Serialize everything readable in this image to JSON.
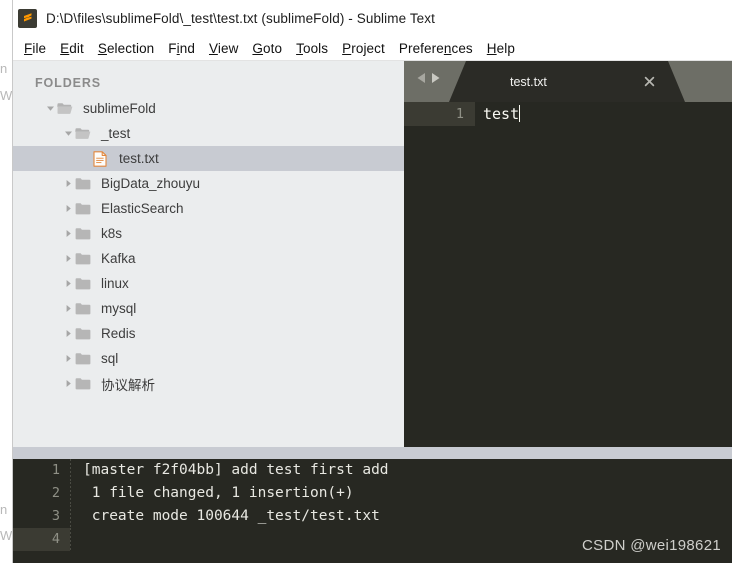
{
  "window": {
    "title": "D:\\D\\files\\sublimeFold\\_test\\test.txt (sublimeFold) - Sublime Text",
    "logo_icon": "sublime-text-logo"
  },
  "menu": {
    "items": [
      {
        "label": "File",
        "accel_index": 0
      },
      {
        "label": "Edit",
        "accel_index": 0
      },
      {
        "label": "Selection",
        "accel_index": 0
      },
      {
        "label": "Find",
        "accel_index": 1
      },
      {
        "label": "View",
        "accel_index": 0
      },
      {
        "label": "Goto",
        "accel_index": 0
      },
      {
        "label": "Tools",
        "accel_index": 0
      },
      {
        "label": "Project",
        "accel_index": 0
      },
      {
        "label": "Preferences",
        "accel_index": 7
      },
      {
        "label": "Help",
        "accel_index": 0
      }
    ]
  },
  "sidebar": {
    "header": "FOLDERS",
    "tree": [
      {
        "label": "sublimeFold",
        "type": "folder",
        "indent": 1,
        "expanded": true,
        "selected": false,
        "icon": "folder-open-icon",
        "arrow": "chevron-down-icon"
      },
      {
        "label": "_test",
        "type": "folder",
        "indent": 2,
        "expanded": true,
        "selected": false,
        "icon": "folder-open-icon",
        "arrow": "chevron-down-icon"
      },
      {
        "label": "test.txt",
        "type": "file",
        "indent": 3,
        "expanded": false,
        "selected": true,
        "icon": "file-text-icon",
        "arrow": "none"
      },
      {
        "label": "BigData_zhouyu",
        "type": "folder",
        "indent": 2,
        "expanded": false,
        "selected": false,
        "icon": "folder-icon",
        "arrow": "chevron-right-icon"
      },
      {
        "label": "ElasticSearch",
        "type": "folder",
        "indent": 2,
        "expanded": false,
        "selected": false,
        "icon": "folder-icon",
        "arrow": "chevron-right-icon"
      },
      {
        "label": "k8s",
        "type": "folder",
        "indent": 2,
        "expanded": false,
        "selected": false,
        "icon": "folder-icon",
        "arrow": "chevron-right-icon"
      },
      {
        "label": "Kafka",
        "type": "folder",
        "indent": 2,
        "expanded": false,
        "selected": false,
        "icon": "folder-icon",
        "arrow": "chevron-right-icon"
      },
      {
        "label": "linux",
        "type": "folder",
        "indent": 2,
        "expanded": false,
        "selected": false,
        "icon": "folder-icon",
        "arrow": "chevron-right-icon"
      },
      {
        "label": "mysql",
        "type": "folder",
        "indent": 2,
        "expanded": false,
        "selected": false,
        "icon": "folder-icon",
        "arrow": "chevron-right-icon"
      },
      {
        "label": "Redis",
        "type": "folder",
        "indent": 2,
        "expanded": false,
        "selected": false,
        "icon": "folder-icon",
        "arrow": "chevron-right-icon"
      },
      {
        "label": "sql",
        "type": "folder",
        "indent": 2,
        "expanded": false,
        "selected": false,
        "icon": "folder-icon",
        "arrow": "chevron-right-icon"
      },
      {
        "label": "协议解析",
        "type": "folder",
        "indent": 2,
        "expanded": false,
        "selected": false,
        "icon": "folder-icon",
        "arrow": "chevron-right-icon"
      }
    ]
  },
  "editor": {
    "nav": {
      "prev_icon": "triangle-left-icon",
      "next_icon": "triangle-right-icon"
    },
    "tab": {
      "label": "test.txt",
      "close_icon": "close-icon",
      "active": true
    },
    "lines": [
      {
        "number": "1",
        "text": "test",
        "current": true,
        "caret": true
      }
    ]
  },
  "console": {
    "lines": [
      {
        "number": "1",
        "text": "[master f2f04bb] add test first add",
        "current": false
      },
      {
        "number": "2",
        "text": " 1 file changed, 1 insertion(+)",
        "current": false
      },
      {
        "number": "3",
        "text": " create mode 100644 _test/test.txt",
        "current": false
      },
      {
        "number": "4",
        "text": "",
        "current": true
      }
    ]
  },
  "watermark": {
    "text": "CSDN @wei198621"
  },
  "ghost_text": {
    "letters": [
      "n",
      "W",
      "n",
      "W"
    ]
  },
  "colors": {
    "chrome_bg": "#ffffff",
    "sidebar_bg": "#ebedee",
    "sidebar_selected": "#c8cbd2",
    "editor_bg": "#272822",
    "tabbar_bg": "#6d6e66",
    "gutter_current": "#3b3b33",
    "accent_orange": "#e2873c",
    "code_fg": "#f8f8f2",
    "gutter_fg": "#8f9086"
  }
}
